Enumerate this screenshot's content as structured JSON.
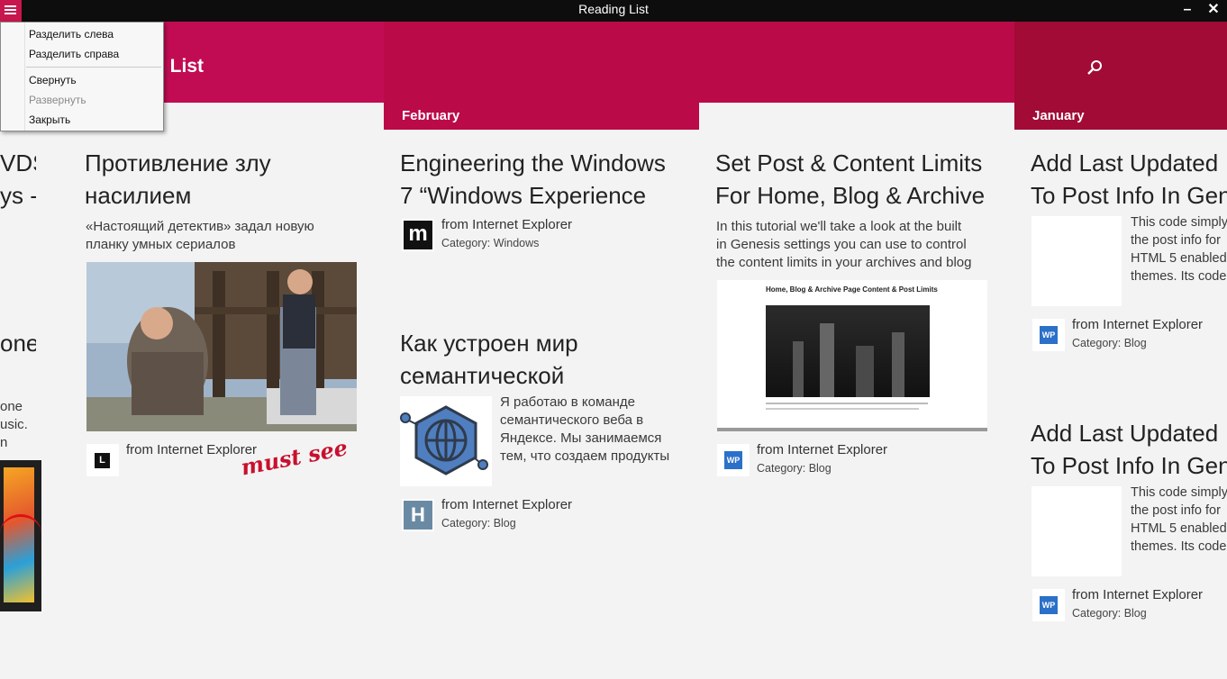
{
  "window": {
    "title": "Reading List"
  },
  "app": {
    "title_fragment": "g List"
  },
  "groups": {
    "february": "February",
    "january": "January"
  },
  "menu": {
    "items": [
      "Разделить слева",
      "Разделить справа",
      "Свернуть",
      "Развернуть",
      "Закрыть"
    ],
    "disabled": [
      "Развернуть"
    ]
  },
  "left_partial": {
    "lines_a": [
      "VDS",
      "ys -"
    ],
    "line_b": "one",
    "lines_c": [
      "one",
      "usic.",
      "n"
    ]
  },
  "articles": [
    {
      "title_lines": [
        "Противление злу",
        "насилием"
      ],
      "desc_lines": [
        "«Настоящий детектив» задал новую",
        "планку умных сериалов"
      ],
      "source": "from Internet Explorer",
      "source_icon": "L",
      "annotation": "must see"
    },
    {
      "title_lines": [
        "Engineering the Windows",
        "7 “Windows Experience"
      ],
      "source": "from Internet Explorer",
      "category_label": "Category:",
      "category": "Windows",
      "source_icon": "m"
    },
    {
      "title_lines": [
        "Как устроен мир",
        "семантической"
      ],
      "desc_lines": [
        "Я работаю в команде",
        "семантического веба в",
        "Яндексе. Мы занимаемся",
        "тем, что создаем продукты"
      ],
      "source": "from Internet Explorer",
      "category_label": "Category:",
      "category": "Blog",
      "source_icon": "H"
    },
    {
      "title_lines": [
        "Set Post & Content Limits",
        "For Home, Blog & Archive"
      ],
      "desc_lines": [
        "In this tutorial we'll take a look at the built",
        "in Genesis settings you can use to control",
        "the content limits in your archives and blog"
      ],
      "thumb_title": "Home, Blog & Archive Page Content & Post Limits",
      "source": "from Internet Explorer",
      "category_label": "Category:",
      "category": "Blog",
      "source_icon": "WP"
    },
    {
      "title_lines": [
        "Add Last Updated",
        "To Post Info In Gen"
      ],
      "desc_lines": [
        "This code simply",
        "the post info for",
        "HTML 5 enabled",
        "themes. Its code"
      ],
      "source": "from Internet Explorer",
      "category_label": "Category:",
      "category": "Blog",
      "source_icon": "WP"
    },
    {
      "title_lines": [
        "Add Last Updated",
        "To Post Info In Gen"
      ],
      "desc_lines": [
        "This code simply",
        "the post info for",
        "HTML 5 enabled",
        "themes. Its code"
      ],
      "source": "from Internet Explorer",
      "category_label": "Category:",
      "category": "Blog",
      "source_icon": "WP"
    }
  ],
  "colors": {
    "accent": "#c10c54",
    "header2": "#bb0a48",
    "header3": "#a10b35",
    "titlebar": "#0d0d0d"
  },
  "icons": [
    "menu-icon",
    "minimize-icon",
    "close-icon",
    "search-icon"
  ]
}
